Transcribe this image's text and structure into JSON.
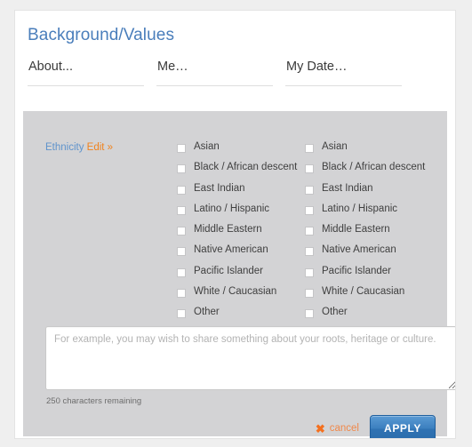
{
  "page": {
    "title": "Background/Values"
  },
  "tabs": [
    {
      "label": "About..."
    },
    {
      "label": "Me…"
    },
    {
      "label": "My Date…"
    }
  ],
  "field": {
    "name": "Ethnicity",
    "edit_label": "Edit »"
  },
  "checkbox_columns": [
    {
      "name": "ethnicity-self",
      "options": [
        {
          "label": "Asian",
          "checked": false
        },
        {
          "label": "Black / African descent",
          "checked": false
        },
        {
          "label": "East Indian",
          "checked": false
        },
        {
          "label": "Latino / Hispanic",
          "checked": false
        },
        {
          "label": "Middle Eastern",
          "checked": false
        },
        {
          "label": "Native American",
          "checked": false
        },
        {
          "label": "Pacific Islander",
          "checked": false
        },
        {
          "label": "White / Caucasian",
          "checked": false
        },
        {
          "label": "Other",
          "checked": false
        }
      ]
    },
    {
      "name": "ethnicity-match",
      "options": [
        {
          "label": "Asian",
          "checked": false
        },
        {
          "label": "Black / African descent",
          "checked": false
        },
        {
          "label": "East Indian",
          "checked": false
        },
        {
          "label": "Latino / Hispanic",
          "checked": false
        },
        {
          "label": "Middle Eastern",
          "checked": false
        },
        {
          "label": "Native American",
          "checked": false
        },
        {
          "label": "Pacific Islander",
          "checked": false
        },
        {
          "label": "White / Caucasian",
          "checked": false
        },
        {
          "label": "Other",
          "checked": false
        }
      ]
    }
  ],
  "note": {
    "value": "",
    "placeholder": "For example, you may wish to share something about your roots, heritage or culture.",
    "characters_remaining": "250 characters remaining"
  },
  "actions": {
    "cancel_icon": "✖",
    "cancel_label": "cancel",
    "apply_label": "APPLY"
  },
  "colors": {
    "title_blue": "#4a7ebb",
    "accent_orange": "#f0831e",
    "apply_blue": "#2f72b3",
    "panel_gray": "#d3d3d5",
    "page_gray": "#efefef"
  }
}
